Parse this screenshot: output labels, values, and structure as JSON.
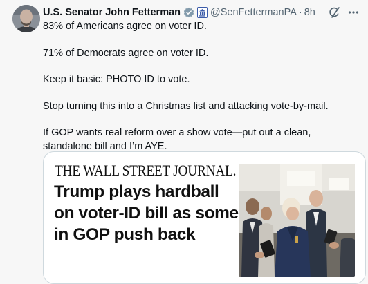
{
  "author": {
    "name": "U.S. Senator John Fetterman",
    "handle": "@SenFettermanPA",
    "separator": "·",
    "time": "8h"
  },
  "tweet": {
    "paragraphs": [
      "83% of Americans agree on voter ID.",
      "71% of Democrats agree on voter ID.",
      "Keep it basic: PHOTO ID to vote.",
      "Stop turning this into a Christmas list and attacking vote-by-mail.",
      "If GOP wants real reform over a show vote—put out a clean, standalone bill and I’m AYE."
    ]
  },
  "card": {
    "source": "THE WALL STREET JOURNAL.",
    "headline": "Trump plays hardball on voter-ID bill as some in GOP push back"
  },
  "icons": {
    "verified": "verified-badge-icon",
    "government": "government-badge-icon",
    "grok": "grok-icon",
    "more": "more-icon"
  },
  "colors": {
    "verified": "#829aab",
    "government_badge": "#3b5ba9",
    "secondary_text": "#536471"
  }
}
